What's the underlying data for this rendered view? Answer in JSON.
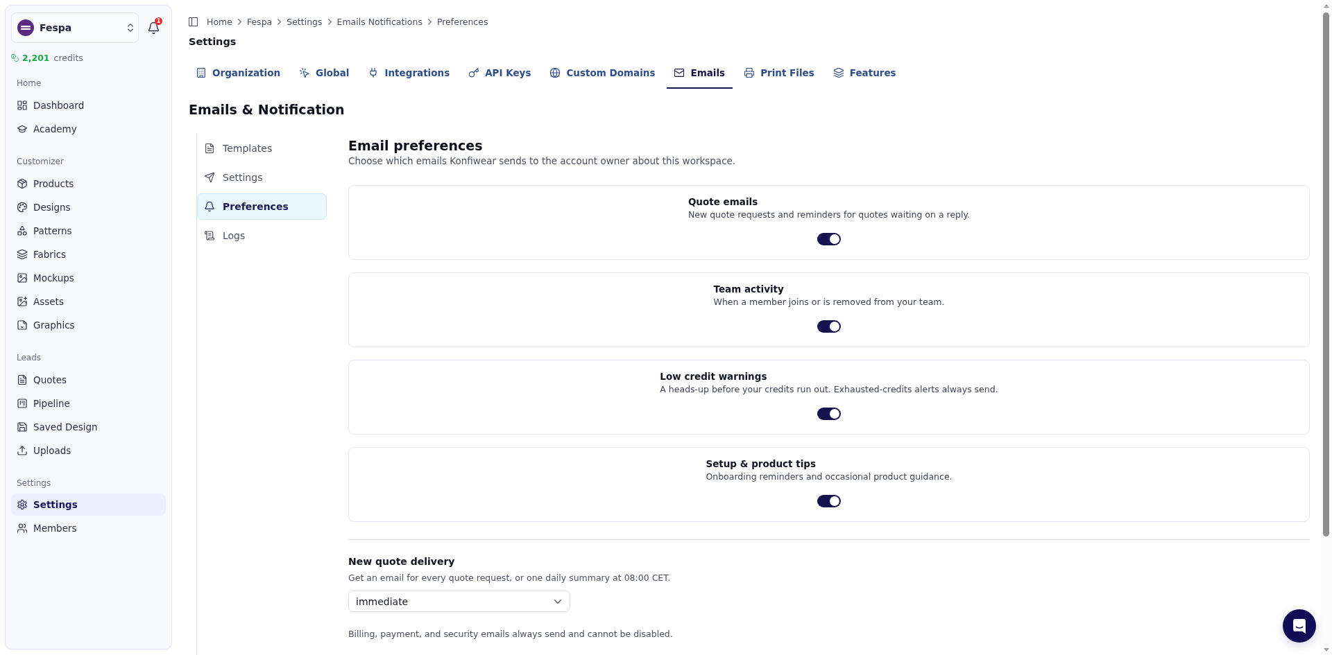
{
  "sidebar": {
    "workspace": {
      "name": "Fespa"
    },
    "notifications": {
      "badge": "1"
    },
    "credits": {
      "amount": "2,201",
      "label": "credits"
    },
    "sections": [
      {
        "title": "Home",
        "items": [
          {
            "label": "Dashboard",
            "selected": false
          },
          {
            "label": "Academy",
            "selected": false
          }
        ]
      },
      {
        "title": "Customizer",
        "items": [
          {
            "label": "Products",
            "selected": false
          },
          {
            "label": "Designs",
            "selected": false
          },
          {
            "label": "Patterns",
            "selected": false
          },
          {
            "label": "Fabrics",
            "selected": false
          },
          {
            "label": "Mockups",
            "selected": false
          },
          {
            "label": "Assets",
            "selected": false
          },
          {
            "label": "Graphics",
            "selected": false
          }
        ]
      },
      {
        "title": "Leads",
        "items": [
          {
            "label": "Quotes",
            "selected": false
          },
          {
            "label": "Pipeline",
            "selected": false
          },
          {
            "label": "Saved Design",
            "selected": false
          },
          {
            "label": "Uploads",
            "selected": false
          }
        ]
      },
      {
        "title": "Settings",
        "items": [
          {
            "label": "Settings",
            "selected": true
          },
          {
            "label": "Members",
            "selected": false
          }
        ]
      }
    ]
  },
  "breadcrumb": [
    "Home",
    "Fespa",
    "Settings",
    "Emails Notifications",
    "Preferences"
  ],
  "page_title": "Settings",
  "tabs": [
    {
      "label": "Organization",
      "selected": false
    },
    {
      "label": "Global",
      "selected": false
    },
    {
      "label": "Integrations",
      "selected": false
    },
    {
      "label": "API Keys",
      "selected": false
    },
    {
      "label": "Custom Domains",
      "selected": false
    },
    {
      "label": "Emails",
      "selected": true
    },
    {
      "label": "Print Files",
      "selected": false
    },
    {
      "label": "Features",
      "selected": false
    }
  ],
  "section_title": "Emails & Notification",
  "subnav": [
    {
      "label": "Templates",
      "selected": false
    },
    {
      "label": "Settings",
      "selected": false
    },
    {
      "label": "Preferences",
      "selected": true
    },
    {
      "label": "Logs",
      "selected": false
    }
  ],
  "preferences": {
    "title": "Email preferences",
    "subtitle": "Choose which emails Konfiwear sends to the account owner about this workspace.",
    "items": [
      {
        "title": "Quote emails",
        "description": "New quote requests and reminders for quotes waiting on a reply.",
        "on": true
      },
      {
        "title": "Team activity",
        "description": "When a member joins or is removed from your team.",
        "on": true
      },
      {
        "title": "Low credit warnings",
        "description": "A heads-up before your credits run out. Exhausted-credits alerts always send.",
        "on": true
      },
      {
        "title": "Setup & product tips",
        "description": "Onboarding reminders and occasional product guidance.",
        "on": true
      }
    ]
  },
  "delivery": {
    "label": "New quote delivery",
    "description": "Get an email for every quote request, or one daily summary at 08:00 CET.",
    "value": "immediate"
  },
  "footnote": "Billing, payment, and security emails always send and cannot be disabled."
}
